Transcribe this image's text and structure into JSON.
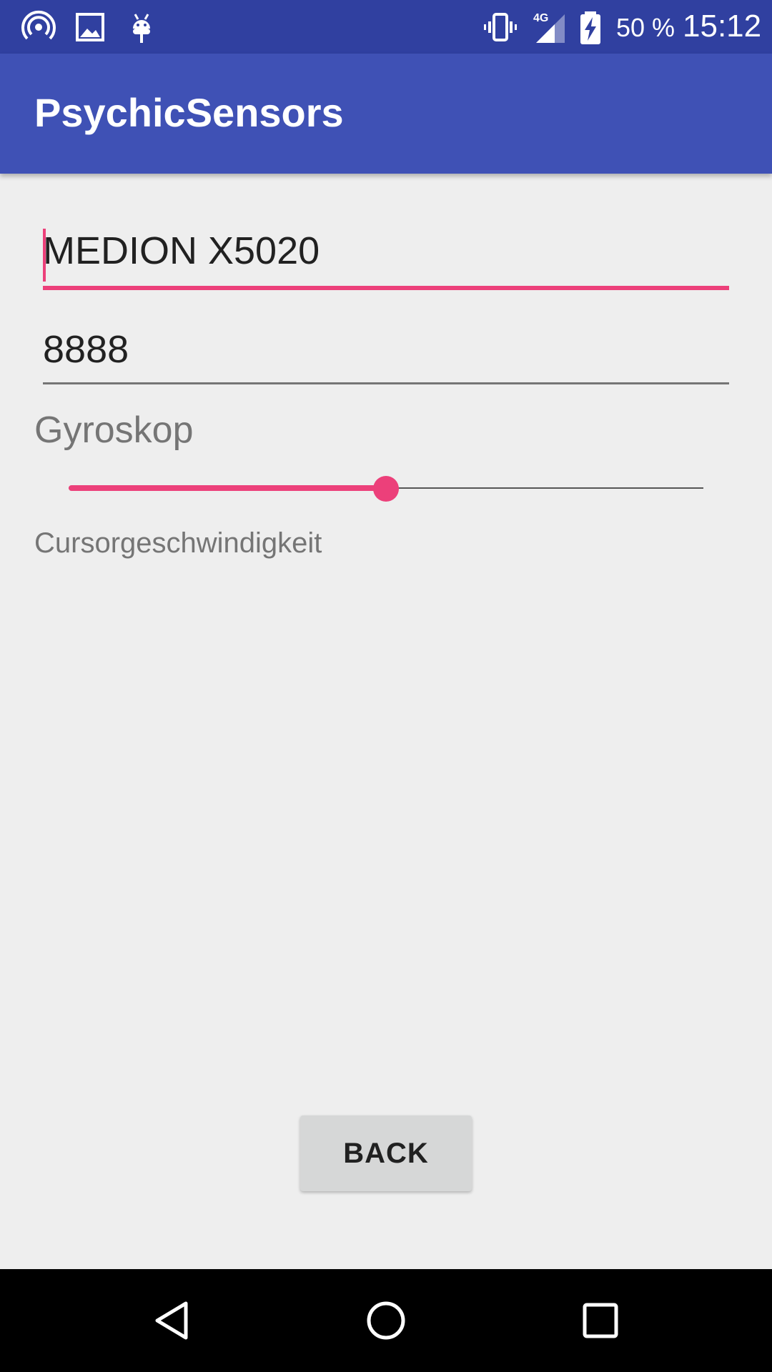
{
  "status_bar": {
    "battery_percent": "50 %",
    "time": "15:12",
    "icons": [
      "hotspot-icon",
      "image-icon",
      "android-debug-icon",
      "vibrate-icon",
      "signal-4g-icon",
      "battery-charging-icon"
    ]
  },
  "app_bar": {
    "title": "PsychicSensors"
  },
  "form": {
    "device_name": {
      "value": "MEDION X5020"
    },
    "port": {
      "value": "8888"
    },
    "section_label": "Gyroskop",
    "speed_slider": {
      "value_fraction": 0.5
    },
    "speed_caption": "Cursorgeschwindigkeit"
  },
  "back_button": {
    "label": "BACK"
  },
  "colors": {
    "primary": "#3f51b5",
    "primary_dark": "#3040a0",
    "accent": "#ec407a"
  },
  "nav_bar": {
    "icons": [
      "back-triangle-icon",
      "home-circle-icon",
      "recents-square-icon"
    ]
  }
}
